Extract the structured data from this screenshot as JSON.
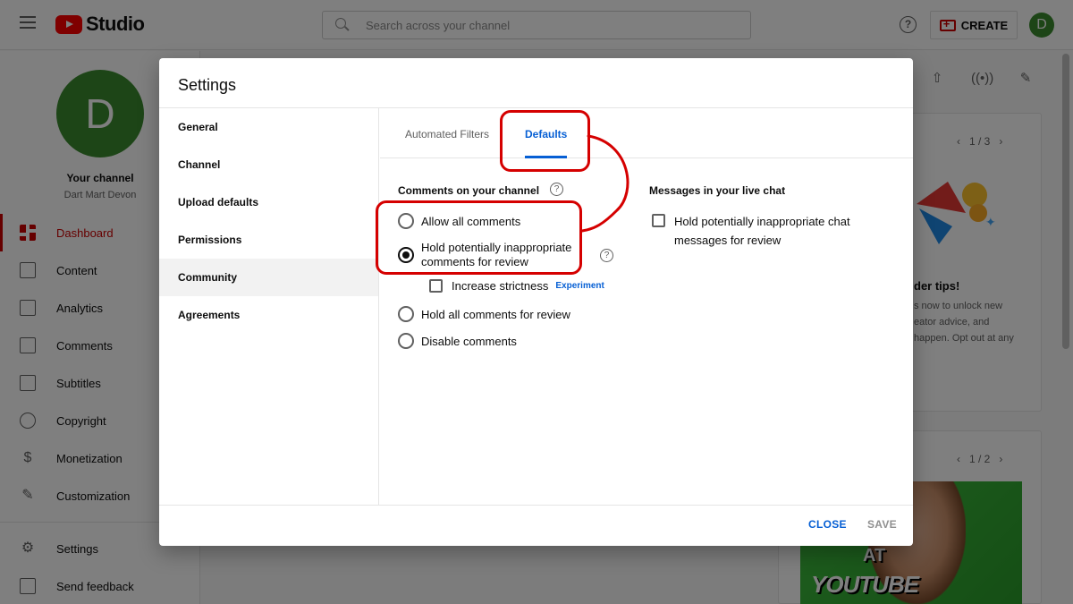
{
  "app": {
    "logo_text": "Studio",
    "search_placeholder": "Search across your channel",
    "create_label": "CREATE",
    "avatar_initial": "D",
    "help_glyph": "?"
  },
  "sidebar": {
    "avatar_initial": "D",
    "channel_title": "Your channel",
    "channel_name": "Dart Mart Devon",
    "items": [
      {
        "label": "Dashboard",
        "icon": "dashboard-icon",
        "active": true
      },
      {
        "label": "Content",
        "icon": "content-icon"
      },
      {
        "label": "Analytics",
        "icon": "analytics-icon"
      },
      {
        "label": "Comments",
        "icon": "comments-icon"
      },
      {
        "label": "Subtitles",
        "icon": "subtitles-icon"
      },
      {
        "label": "Copyright",
        "icon": "copyright-icon"
      },
      {
        "label": "Monetization",
        "icon": "monetization-icon"
      },
      {
        "label": "Customization",
        "icon": "customization-icon"
      }
    ],
    "bottom_items": [
      {
        "label": "Settings",
        "icon": "gear-icon"
      },
      {
        "label": "Send feedback",
        "icon": "feedback-icon"
      }
    ]
  },
  "background": {
    "pager_1": "1 / 3",
    "pager_2": "1 / 2",
    "tips_title": "der tips!",
    "tips_line1": "s now to unlock new",
    "tips_line2": "eator advice, and",
    "tips_line3": "happen. Opt out at any",
    "thumb_text_1": "AT",
    "thumb_text_2": "YOUTUBE"
  },
  "dialog": {
    "title": "Settings",
    "nav": [
      "General",
      "Channel",
      "Upload defaults",
      "Permissions",
      "Community",
      "Agreements"
    ],
    "active_nav": "Community",
    "tabs": {
      "filters": "Automated Filters",
      "defaults": "Defaults"
    },
    "active_tab": "Defaults",
    "comments_section": {
      "title": "Comments on your channel",
      "options": [
        {
          "label": "Allow all comments",
          "checked": false
        },
        {
          "label_line1": "Hold potentially inappropriate",
          "label_line2": "comments for review",
          "checked": true
        },
        {
          "label": "Hold all comments for review",
          "checked": false
        },
        {
          "label": "Disable comments",
          "checked": false
        }
      ],
      "strictness_label": "Increase strictness",
      "strictness_badge": "Experiment",
      "strictness_checked": false
    },
    "live_chat_section": {
      "title": "Messages in your live chat",
      "option_line1": "Hold potentially inappropriate chat",
      "option_line2": "messages for review",
      "checked": false
    },
    "footer": {
      "close": "CLOSE",
      "save": "SAVE"
    }
  },
  "colors": {
    "accent_blue": "#065fd4",
    "brand_red": "#ff0000",
    "annotation_red": "#d50000",
    "avatar_green": "#3b8a2e"
  }
}
